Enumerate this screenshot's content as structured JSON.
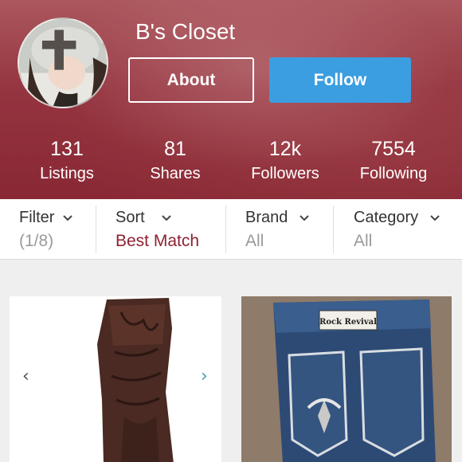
{
  "profile": {
    "closet_name": "B's Closet",
    "about_label": "About",
    "follow_label": "Follow"
  },
  "stats": [
    {
      "value": "131",
      "label": "Listings"
    },
    {
      "value": "81",
      "label": "Shares"
    },
    {
      "value": "12k",
      "label": "Followers"
    },
    {
      "value": "7554",
      "label": "Following"
    }
  ],
  "filters": [
    {
      "title": "Filter",
      "value": "(1/8)"
    },
    {
      "title": "Sort",
      "value": "Best Match"
    },
    {
      "title": "Brand",
      "value": "All"
    },
    {
      "title": "Category",
      "value": "All"
    }
  ],
  "listings": [
    {
      "image": "brown-cowboy-boot-photo",
      "prev_icon": "‹",
      "next_icon": "›"
    },
    {
      "image": "rock-revival-jeans-photo",
      "tag_text": "Rock Revival"
    }
  ],
  "colors": {
    "follow_button": "#3a9ee0",
    "accent": "#8d2133",
    "header_tint": "#9b3c47"
  }
}
